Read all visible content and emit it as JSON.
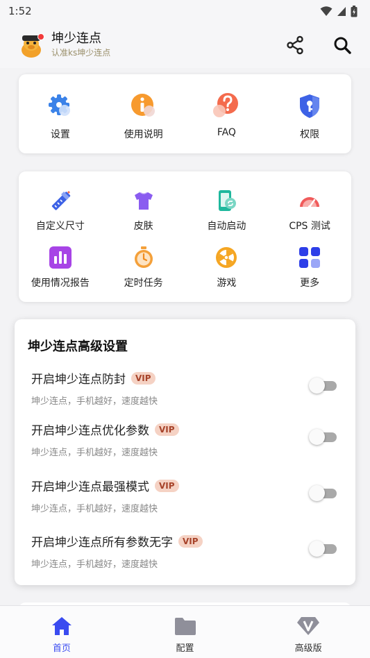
{
  "status_bar": {
    "time": "1:52"
  },
  "header": {
    "app_name": "坤少连点",
    "subtitle": "认准ks坤少连点"
  },
  "quick_menu": [
    {
      "label": "设置",
      "icon": "gear-icon"
    },
    {
      "label": "使用说明",
      "icon": "info-icon"
    },
    {
      "label": "FAQ",
      "icon": "question-icon"
    },
    {
      "label": "权限",
      "icon": "shield-key-icon"
    }
  ],
  "tools": [
    {
      "label": "自定义尺寸",
      "icon": "ruler-pencil-icon"
    },
    {
      "label": "皮肤",
      "icon": "shirt-icon"
    },
    {
      "label": "自动启动",
      "icon": "phone-link-icon"
    },
    {
      "label": "CPS 测试",
      "icon": "speedometer-icon"
    },
    {
      "label": "使用情况报告",
      "icon": "bar-chart-icon"
    },
    {
      "label": "定时任务",
      "icon": "stopwatch-icon"
    },
    {
      "label": "游戏",
      "icon": "wheel-icon"
    },
    {
      "label": "更多",
      "icon": "grid-more-icon"
    }
  ],
  "advanced": {
    "title": "坤少连点高级设置",
    "badge": "VIP",
    "items": [
      {
        "title": "开启坤少连点防封",
        "desc": "坤少连点，手机越好，速度越快",
        "enabled": false
      },
      {
        "title": "开启坤少连点优化参数",
        "desc": "坤少连点，手机越好，速度越快",
        "enabled": false
      },
      {
        "title": "开启坤少连点最强模式",
        "desc": "坤少连点，手机越好，速度越快",
        "enabled": false
      },
      {
        "title": "开启坤少连点所有参数无字",
        "desc": "坤少连点，手机越好，速度越快",
        "enabled": false
      }
    ]
  },
  "bottom_nav": [
    {
      "label": "首页",
      "icon": "home-icon",
      "active": true
    },
    {
      "label": "配置",
      "icon": "folder-icon",
      "active": false
    },
    {
      "label": "高级版",
      "icon": "diamond-v-icon",
      "active": false
    }
  ],
  "colors": {
    "accent": "#3a4bf0",
    "vip_bg": "#f5d2c4",
    "vip_text": "#a7432a",
    "toggle_off": "#a9a9a9"
  }
}
